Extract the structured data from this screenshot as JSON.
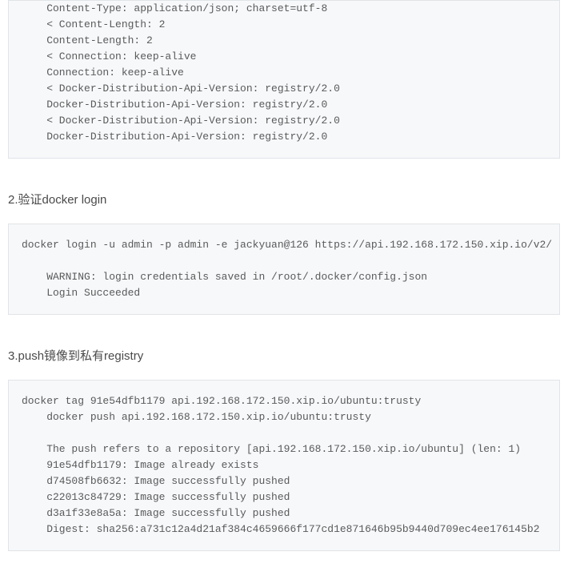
{
  "block1": {
    "lines": [
      "    Content-Type: application/json; charset=utf-8",
      "    < Content-Length: 2",
      "    Content-Length: 2",
      "    < Connection: keep-alive",
      "    Connection: keep-alive",
      "    < Docker-Distribution-Api-Version: registry/2.0",
      "    Docker-Distribution-Api-Version: registry/2.0",
      "    < Docker-Distribution-Api-Version: registry/2.0",
      "    Docker-Distribution-Api-Version: registry/2.0"
    ]
  },
  "section2": {
    "title": "2.验证docker login"
  },
  "block2": {
    "lines": [
      "docker login -u admin -p admin -e jackyuan@126 https://api.192.168.172.150.xip.io/v2/",
      "",
      "    WARNING: login credentials saved in /root/.docker/config.json",
      "    Login Succeeded"
    ]
  },
  "section3": {
    "title": "3.push镜像到私有registry"
  },
  "block3": {
    "lines": [
      "docker tag 91e54dfb1179 api.192.168.172.150.xip.io/ubuntu:trusty",
      "    docker push api.192.168.172.150.xip.io/ubuntu:trusty",
      "",
      "    The push refers to a repository [api.192.168.172.150.xip.io/ubuntu] (len: 1)",
      "    91e54dfb1179: Image already exists",
      "    d74508fb6632: Image successfully pushed",
      "    c22013c84729: Image successfully pushed",
      "    d3a1f33e8a5a: Image successfully pushed",
      "    Digest: sha256:a731c12a4d21af384c4659666f177cd1e871646b95b9440d709ec4ee176145b2"
    ]
  }
}
